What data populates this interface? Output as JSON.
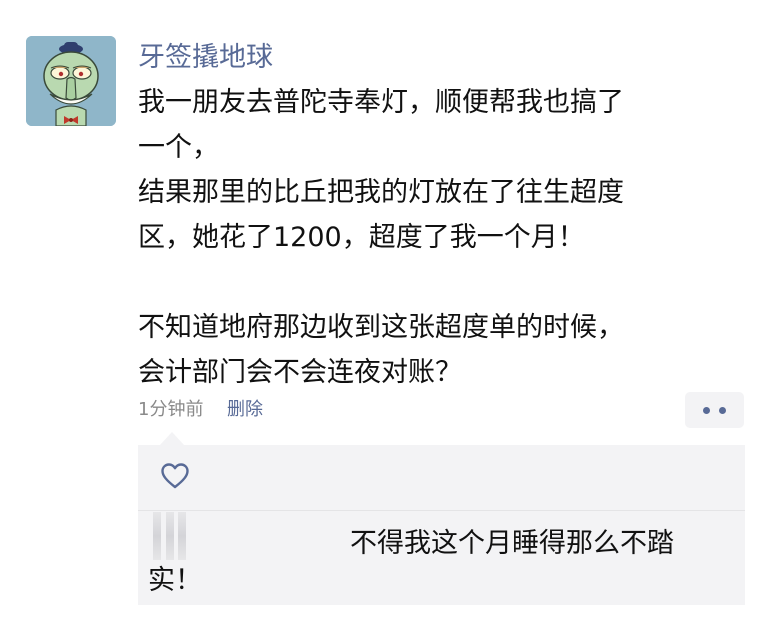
{
  "post": {
    "author": "牙签撬地球",
    "lines": [
      "我一朋友去普陀寺奉灯，顺便帮我也搞了",
      "一个，",
      "结果那里的比丘把我的灯放在了往生超度",
      "区，她花了1200，超度了我一个月！",
      "",
      "不知道地府那边收到这张超度单的时候，",
      "会计部门会不会连夜对账？"
    ],
    "time": "1分钟前",
    "delete_label": "删除"
  },
  "comment": {
    "line1": "不得我这个月睡得那么不踏",
    "line2": "实！"
  },
  "icons": {
    "avatar": "squidward-avatar-icon",
    "like": "heart-outline-icon",
    "more": "more-dots-icon"
  },
  "colors": {
    "name_link": "#586a96",
    "background": "#ffffff",
    "comment_bg": "#f3f3f5",
    "meta_gray": "#8a8a8a",
    "avatar_bg": "#8fb6c9"
  }
}
